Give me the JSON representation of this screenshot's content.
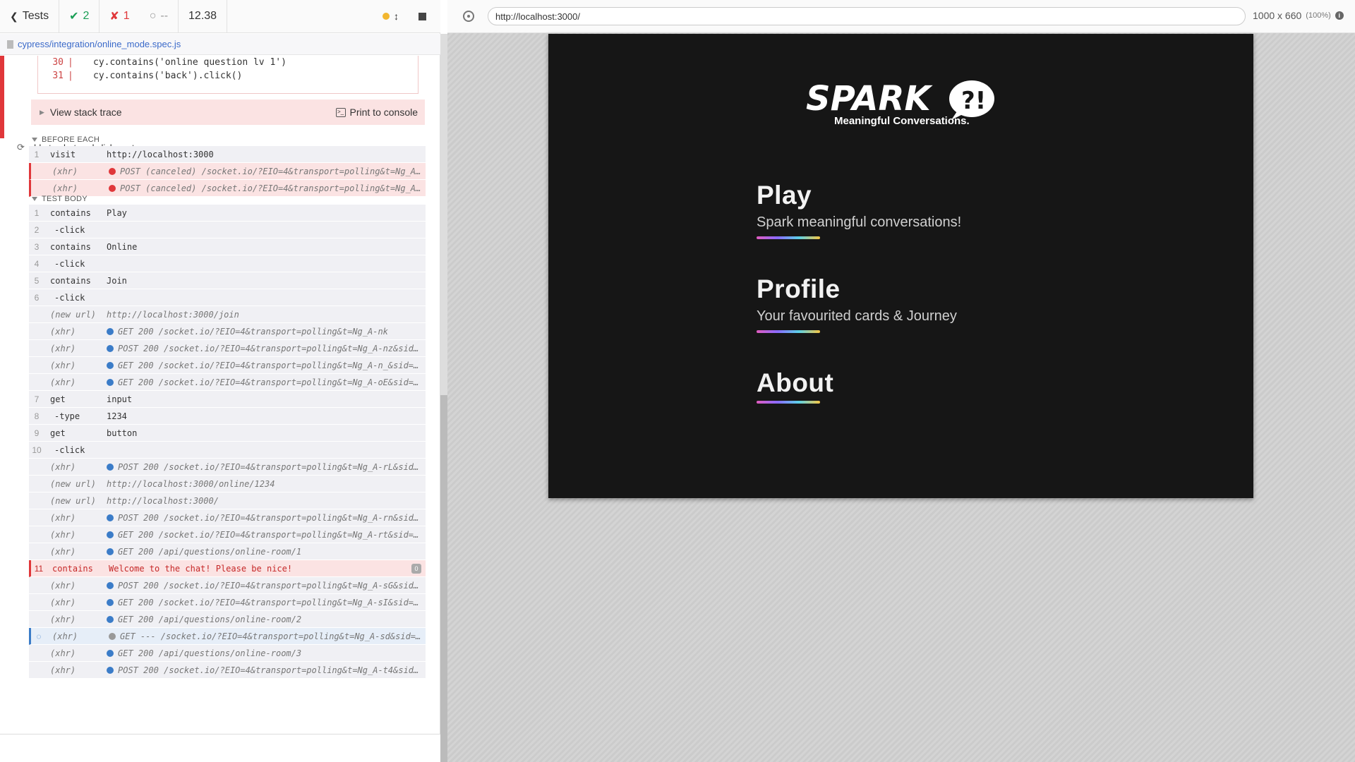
{
  "reporter": {
    "back_label": "Tests",
    "passed": "2",
    "failed": "1",
    "pending": "--",
    "duration": "12.38",
    "spec_path": "cypress/integration/online_mode.spec.js"
  },
  "error": {
    "code_lines": [
      {
        "ln": "30",
        "code": "cy.contains('online question lv 1')"
      },
      {
        "ln": "31",
        "code": "cy.contains('back').click()"
      }
    ],
    "stack_trace_label": "View stack trace",
    "print_label": "Print to console"
  },
  "test": {
    "title": "able to chat and click next",
    "before_each_label": "BEFORE EACH",
    "test_body_label": "TEST BODY",
    "before_each": [
      {
        "num": "1",
        "name": "visit",
        "msg": "http://localhost:3000",
        "kind": "cmd"
      },
      {
        "num": "",
        "name": "(xhr)",
        "msg": "POST (canceled) /socket.io/?EIO=4&transport=polling&t=Ng_A…",
        "kind": "event-red"
      },
      {
        "num": "",
        "name": "(xhr)",
        "msg": "POST (canceled) /socket.io/?EIO=4&transport=polling&t=Ng_A…",
        "kind": "event-red"
      }
    ],
    "body": [
      {
        "num": "1",
        "name": "contains",
        "msg": "Play",
        "kind": "cmd"
      },
      {
        "num": "2",
        "name": "-click",
        "msg": "",
        "kind": "child"
      },
      {
        "num": "3",
        "name": "contains",
        "msg": "Online",
        "kind": "cmd"
      },
      {
        "num": "4",
        "name": "-click",
        "msg": "",
        "kind": "child"
      },
      {
        "num": "5",
        "name": "contains",
        "msg": "Join",
        "kind": "cmd"
      },
      {
        "num": "6",
        "name": "-click",
        "msg": "",
        "kind": "child"
      },
      {
        "num": "",
        "name": "(new url)",
        "msg": "http://localhost:3000/join",
        "kind": "event"
      },
      {
        "num": "",
        "name": "(xhr)",
        "msg": "GET 200 /socket.io/?EIO=4&transport=polling&t=Ng_A-nk",
        "kind": "event-blue"
      },
      {
        "num": "",
        "name": "(xhr)",
        "msg": "POST 200 /socket.io/?EIO=4&transport=polling&t=Ng_A-nz&sid…",
        "kind": "event-blue"
      },
      {
        "num": "",
        "name": "(xhr)",
        "msg": "GET 200 /socket.io/?EIO=4&transport=polling&t=Ng_A-n_&sid=…",
        "kind": "event-blue"
      },
      {
        "num": "",
        "name": "(xhr)",
        "msg": "GET 200 /socket.io/?EIO=4&transport=polling&t=Ng_A-oE&sid=…",
        "kind": "event-blue"
      },
      {
        "num": "7",
        "name": "get",
        "msg": "input",
        "kind": "cmd"
      },
      {
        "num": "8",
        "name": "-type",
        "msg": "1234",
        "kind": "child"
      },
      {
        "num": "9",
        "name": "get",
        "msg": "button",
        "kind": "cmd"
      },
      {
        "num": "10",
        "name": "-click",
        "msg": "",
        "kind": "child"
      },
      {
        "num": "",
        "name": "(xhr)",
        "msg": "POST 200 /socket.io/?EIO=4&transport=polling&t=Ng_A-rL&sid…",
        "kind": "event-blue"
      },
      {
        "num": "",
        "name": "(new url)",
        "msg": "http://localhost:3000/online/1234",
        "kind": "event"
      },
      {
        "num": "",
        "name": "(new url)",
        "msg": "http://localhost:3000/",
        "kind": "event"
      },
      {
        "num": "",
        "name": "(xhr)",
        "msg": "POST 200 /socket.io/?EIO=4&transport=polling&t=Ng_A-rn&sid…",
        "kind": "event-blue"
      },
      {
        "num": "",
        "name": "(xhr)",
        "msg": "GET 200 /socket.io/?EIO=4&transport=polling&t=Ng_A-rt&sid=…",
        "kind": "event-blue"
      },
      {
        "num": "",
        "name": "(xhr)",
        "msg": "GET 200 /api/questions/online-room/1",
        "kind": "event-blue"
      },
      {
        "num": "11",
        "name": "contains",
        "msg": "Welcome to the chat! Please be nice!",
        "kind": "failed",
        "badge": "0"
      },
      {
        "num": "",
        "name": "(xhr)",
        "msg": "POST 200 /socket.io/?EIO=4&transport=polling&t=Ng_A-sG&sid…",
        "kind": "event-blue"
      },
      {
        "num": "",
        "name": "(xhr)",
        "msg": "GET 200 /socket.io/?EIO=4&transport=polling&t=Ng_A-sI&sid=…",
        "kind": "event-blue"
      },
      {
        "num": "",
        "name": "(xhr)",
        "msg": "GET 200 /api/questions/online-room/2",
        "kind": "event-blue"
      },
      {
        "num": "",
        "name": "(xhr)",
        "msg": "GET --- /socket.io/?EIO=4&transport=polling&t=Ng_A-sd&sid=…",
        "kind": "pending"
      },
      {
        "num": "",
        "name": "(xhr)",
        "msg": "GET 200 /api/questions/online-room/3",
        "kind": "event-blue"
      },
      {
        "num": "",
        "name": "(xhr)",
        "msg": "POST 200 /socket.io/?EIO=4&transport=polling&t=Ng_A-t4&sid…",
        "kind": "event-blue"
      }
    ]
  },
  "browser": {
    "url": "http://localhost:3000/",
    "viewport": "1000 x 660",
    "zoom": "(100%)",
    "info": "i"
  },
  "app": {
    "logo_word": "SPARK",
    "logo_mark": "?!",
    "tagline": "Meaningful Conversations.",
    "menu": [
      {
        "title": "Play",
        "subtitle": "Spark meaningful conversations!"
      },
      {
        "title": "Profile",
        "subtitle": "Your favourited cards & Journey"
      },
      {
        "title": "About",
        "subtitle": ""
      }
    ]
  },
  "colors": {
    "pass": "#1a9e55",
    "fail": "#e0373a",
    "xhr_dot": "#3b7cc8",
    "app_bg": "#161616"
  }
}
